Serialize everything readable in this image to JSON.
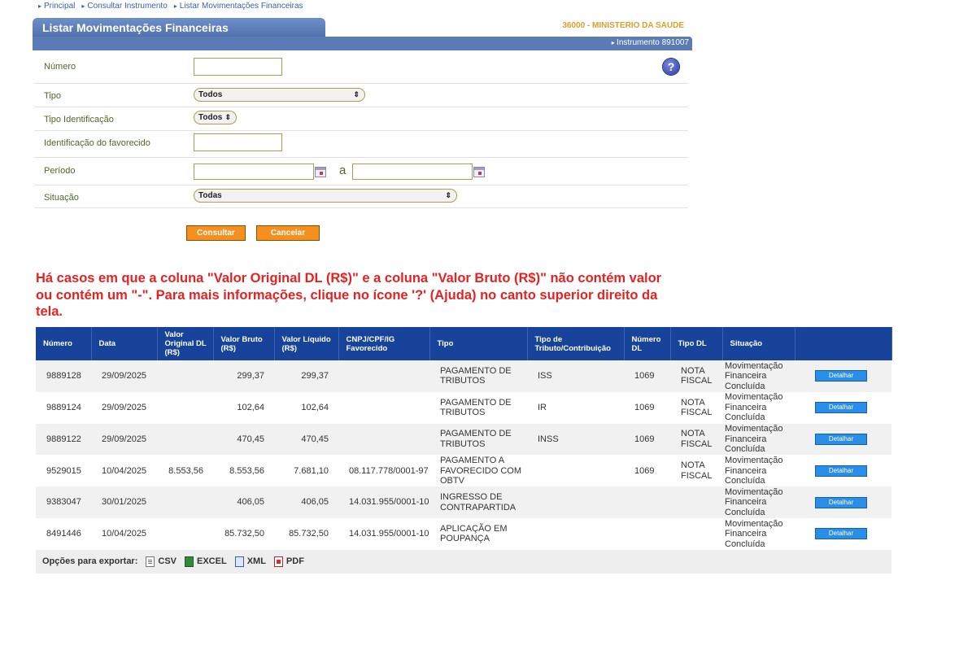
{
  "breadcrumb": [
    "Principal",
    "Consultar Instrumento",
    "Listar Movimentações Financeiras"
  ],
  "header": {
    "title": "Listar Movimentações Financeiras",
    "ministry": "36000 - MINISTERIO DA SAUDE",
    "instrument": "Instrumento 891007",
    "help_icon": "help-icon",
    "help_glyph": "?"
  },
  "form": {
    "numero_label": "Número",
    "numero_value": "",
    "tipo_label": "Tipo",
    "tipo_value": "Todos",
    "tipo_ident_label": "Tipo Identificação",
    "tipo_ident_value": "Todos",
    "ident_fav_label": "Identificação do favorecido",
    "ident_fav_value": "",
    "periodo_label": "Período",
    "periodo_sep": "a",
    "periodo_start": "",
    "periodo_end": "",
    "situacao_label": "Situação",
    "situacao_value": "Todas",
    "consultar_label": "Consultar",
    "cancelar_label": "Cancelar"
  },
  "notice": "Há casos em que a coluna \"Valor Original DL (R$)\" e a coluna \"Valor Bruto (R$)\" não contém valor ou contém um \"-\". Para mais informações, clique no ícone '?' (Ajuda) no canto superior direito da tela.",
  "table": {
    "headers": [
      "Número",
      "Data",
      "Valor Original DL (R$)",
      "Valor Bruto (R$)",
      "Valor Líquido (R$)",
      "CNPJ/CPF/IG Favorecido",
      "Tipo",
      "Tipo de Tributo/Contribuição",
      "Número DL",
      "Tipo DL",
      "Situação",
      ""
    ],
    "rows": [
      {
        "numero": "9889128",
        "data": "29/09/2025",
        "original": "",
        "bruto": "299,37",
        "liquido": "299,37",
        "cnpj": "",
        "tipo": "PAGAMENTO DE TRIBUTOS",
        "tributo": "ISS",
        "num_dl": "1069",
        "tipo_dl": "NOTA FISCAL",
        "situacao": "Movimentação Financeira Concluída",
        "acao": "Detalhar"
      },
      {
        "numero": "9889124",
        "data": "29/09/2025",
        "original": "",
        "bruto": "102,64",
        "liquido": "102,64",
        "cnpj": "",
        "tipo": "PAGAMENTO DE TRIBUTOS",
        "tributo": "IR",
        "num_dl": "1069",
        "tipo_dl": "NOTA FISCAL",
        "situacao": "Movimentação Financeira Concluída",
        "acao": "Detalhar"
      },
      {
        "numero": "9889122",
        "data": "29/09/2025",
        "original": "",
        "bruto": "470,45",
        "liquido": "470,45",
        "cnpj": "",
        "tipo": "PAGAMENTO DE TRIBUTOS",
        "tributo": "INSS",
        "num_dl": "1069",
        "tipo_dl": "NOTA FISCAL",
        "situacao": "Movimentação Financeira Concluída",
        "acao": "Detalhar"
      },
      {
        "numero": "9529015",
        "data": "10/04/2025",
        "original": "8.553,56",
        "bruto": "8.553,56",
        "liquido": "7.681,10",
        "cnpj": "08.117.778/0001-97",
        "tipo": "PAGAMENTO A FAVORECIDO COM OBTV",
        "tributo": "",
        "num_dl": "1069",
        "tipo_dl": "NOTA FISCAL",
        "situacao": "Movimentação Financeira Concluída",
        "acao": "Detalhar"
      },
      {
        "numero": "9383047",
        "data": "30/01/2025",
        "original": "",
        "bruto": "406,05",
        "liquido": "406,05",
        "cnpj": "14.031.955/0001-10",
        "tipo": "INGRESSO DE CONTRAPARTIDA",
        "tributo": "",
        "num_dl": "",
        "tipo_dl": "",
        "situacao": "Movimentação Financeira Concluída",
        "acao": "Detalhar"
      },
      {
        "numero": "8491446",
        "data": "10/04/2025",
        "original": "",
        "bruto": "85.732,50",
        "liquido": "85.732,50",
        "cnpj": "14.031.955/0001-10",
        "tipo": "APLICAÇÃO EM POUPANÇA",
        "tributo": "",
        "num_dl": "",
        "tipo_dl": "",
        "situacao": "Movimentação Financeira Concluída",
        "acao": "Detalhar"
      }
    ]
  },
  "export": {
    "label": "Opções para exportar:",
    "options": [
      {
        "label": "CSV",
        "icon": "csv-file-icon"
      },
      {
        "label": "EXCEL",
        "icon": "excel-file-icon"
      },
      {
        "label": "XML",
        "icon": "xml-file-icon"
      },
      {
        "label": "PDF",
        "icon": "pdf-file-icon"
      }
    ]
  }
}
